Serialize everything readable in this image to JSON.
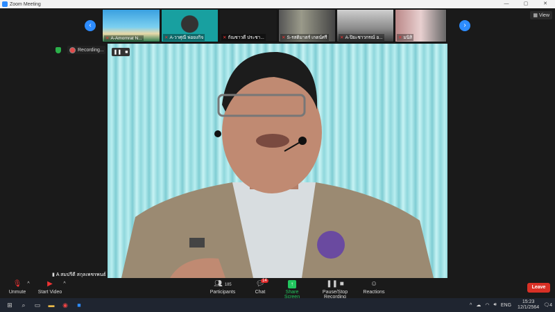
{
  "window": {
    "title": "Zoom Meeting",
    "controls": [
      "—",
      "▢",
      "✕"
    ]
  },
  "gallery": {
    "prev_label": "‹",
    "next_label": "›",
    "view_label": "View",
    "participants": [
      {
        "name": "A-Amornrat N..."
      },
      {
        "name": "A-วาศุณี พ่อยงกิจ"
      },
      {
        "name": "กัณชาวดี ประชา..."
      },
      {
        "name": "S-รสติมาตร์ เกตน์ศรี"
      },
      {
        "name": "A-ปิยะชาวกรณ์ อ..."
      },
      {
        "name": "มนิสิ"
      }
    ]
  },
  "recording": {
    "label": "Recording..."
  },
  "speaker": {
    "name": "A สมปรีดี สกุลเพชรพนธ์"
  },
  "toolbar": {
    "unmute": "Unmute",
    "start_video": "Start Video",
    "participants_count": "185",
    "participants": "Participants",
    "chat": "Chat",
    "chat_badge": "14",
    "share_screen": "Share Screen",
    "pause_stop": "Pause/Stop Recording",
    "reactions": "Reactions",
    "leave": "Leave"
  },
  "taskbar": {
    "lang": "ENG",
    "time": "15:23",
    "date": "12/1/2564",
    "notif_count": "4"
  },
  "colors": {
    "accent": "#2d8cff",
    "leave": "#d93025",
    "share": "#22c55e"
  }
}
